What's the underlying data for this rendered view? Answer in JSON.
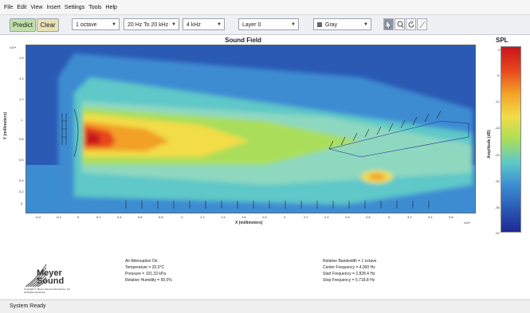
{
  "menu": [
    "File",
    "Edit",
    "View",
    "Insert",
    "Settings",
    "Tools",
    "Help"
  ],
  "toolbar": {
    "predict": "Predict",
    "clear": "Clear",
    "bandwidth": "1 octave",
    "freq_range": "20 Hz To 20 kHz",
    "frequency": "4 kHz",
    "layer": "Layer 0",
    "color_scheme": "Gray"
  },
  "plot": {
    "title": "Sound Field",
    "xlabel": "X (millimeters)",
    "ylabel": "Y (millimeters)",
    "xscale": "x10⁴",
    "yscale": "x10⁴",
    "xticks": [
      "-0.4",
      "-0.2",
      "0",
      "0.2",
      "0.4",
      "0.6",
      "0.8",
      "1",
      "1.2",
      "1.4",
      "1.6",
      "1.8",
      "2",
      "2.2",
      "2.4",
      "2.6",
      "2.8",
      "3",
      "3.2",
      "3.4",
      "3.6"
    ],
    "yticks": [
      "1.6",
      "1.4",
      "1.2",
      "1",
      "0.8",
      "0.6",
      "0.4",
      "0.2",
      "0"
    ]
  },
  "colorbar": {
    "title": "SPL",
    "label": "Amplitude (dB)",
    "ticks": [
      "0",
      "-6",
      "-12",
      "-18",
      "-24",
      "-30",
      "-36",
      "-42"
    ],
    "colors": [
      "#c8141e",
      "#e8461e",
      "#f2a028",
      "#f2dc46",
      "#aade5a",
      "#5ec8c8",
      "#3c8cd2",
      "#2a5ab4",
      "#1e2896"
    ]
  },
  "logo": {
    "name_line1": "Meyer",
    "name_line2": "Sound",
    "copyright": "Copyright © Meyer Sound Laboratories, Inc.",
    "rights": "All Rights Reserved"
  },
  "info_left": [
    "Air Attenuation On",
    "Temperature = 20.0°C",
    "Pressure = 101.33 kPa",
    "Relative Humidity = 50.0%"
  ],
  "info_right": [
    "Relative Bandwidth = 1 octave",
    "Center Frequency = 4,000 Hz",
    "Start Frequency = 2,828.4 Hz",
    "Stop Frequency = 5,718.8 Hz"
  ],
  "status": "System Ready"
}
